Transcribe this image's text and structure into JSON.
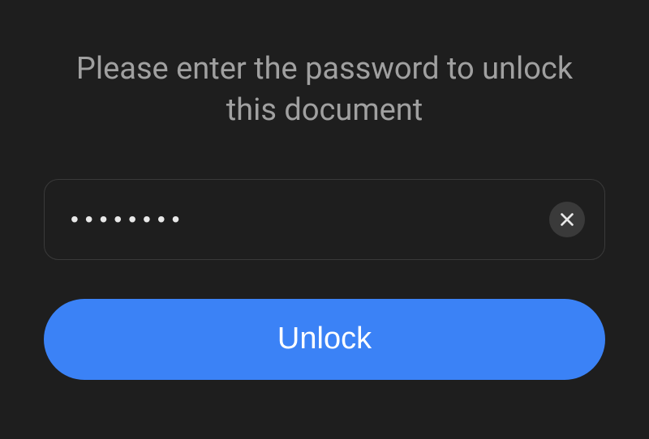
{
  "prompt": "Please enter the password to unlock this document",
  "password": {
    "value": "••••••••",
    "placeholder": ""
  },
  "buttons": {
    "unlock_label": "Unlock"
  },
  "colors": {
    "background": "#1e1e1e",
    "accent": "#3b82f6",
    "text_muted": "#a0a0a0",
    "text_light": "#e8e8e8",
    "input_border": "#3a3a3a",
    "clear_bg": "#3a3a3a"
  }
}
